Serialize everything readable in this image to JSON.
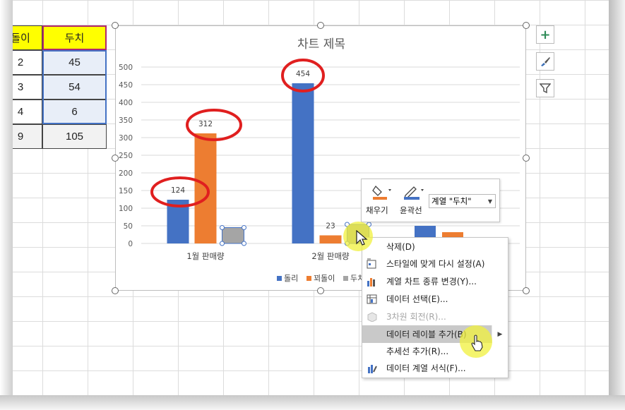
{
  "sheet": {
    "headers": [
      "돌이",
      "두치"
    ],
    "rows": [
      [
        "2",
        "45"
      ],
      [
        "3",
        "54"
      ],
      [
        "4",
        "6"
      ],
      [
        "9",
        "105"
      ]
    ]
  },
  "chart": {
    "title": "차트 제목",
    "legend": [
      "돌리",
      "꾀돌이",
      "두치"
    ],
    "legend_placement": "bottom"
  },
  "chart_data": {
    "type": "bar",
    "title": "차트 제목",
    "categories": [
      "1월 판매량",
      "2월 판매량"
    ],
    "series": [
      {
        "name": "돌리",
        "values": [
          124,
          454
        ],
        "color": "#4472c4"
      },
      {
        "name": "꾀돌이",
        "values": [
          312,
          23
        ],
        "color": "#ed7d31"
      },
      {
        "name": "두치",
        "values": [
          45,
          54
        ],
        "color": "#a5a5a5"
      }
    ],
    "data_labels": {
      "1월 판매량": [
        "124",
        "312",
        ""
      ],
      "2월 판매량": [
        "454",
        "23",
        ""
      ]
    },
    "yticks": [
      "0",
      "50",
      "100",
      "150",
      "200",
      "250",
      "300",
      "350",
      "400",
      "450",
      "500"
    ],
    "ylim": [
      0,
      500
    ],
    "grid": true,
    "annotations": [
      "red-circle-124",
      "red-circle-312",
      "red-circle-454"
    ]
  },
  "side_buttons": [
    {
      "name": "chart-elements-button",
      "icon": "plus-icon"
    },
    {
      "name": "chart-styles-button",
      "icon": "brush-icon"
    },
    {
      "name": "chart-filters-button",
      "icon": "filter-icon"
    }
  ],
  "mini_toolbar": {
    "fill_label": "채우기",
    "outline_label": "윤곽선",
    "series_select": "계열 \"두치\"",
    "fill_color": "#ed7d31",
    "outline_color": "#4472c4"
  },
  "context_menu": [
    {
      "label": "삭제(D)",
      "icon": "",
      "disabled": false
    },
    {
      "label": "스타일에 맞게 다시 설정(A)",
      "icon": "reset-style-icon",
      "disabled": false
    },
    {
      "label": "계열 차트 종류 변경(Y)...",
      "icon": "chart-type-icon",
      "disabled": false
    },
    {
      "label": "데이터 선택(E)...",
      "icon": "select-data-icon",
      "disabled": false
    },
    {
      "label": "3차원 회전(R)...",
      "icon": "rotate-3d-icon",
      "disabled": true
    },
    {
      "label": "데이터 레이블 추가(B)",
      "icon": "",
      "disabled": false,
      "submenu": true,
      "highlighted": true
    },
    {
      "label": "추세선 추가(R)...",
      "icon": "",
      "disabled": false
    },
    {
      "label": "데이터 계열 서식(F)...",
      "icon": "format-series-icon",
      "disabled": false
    }
  ]
}
